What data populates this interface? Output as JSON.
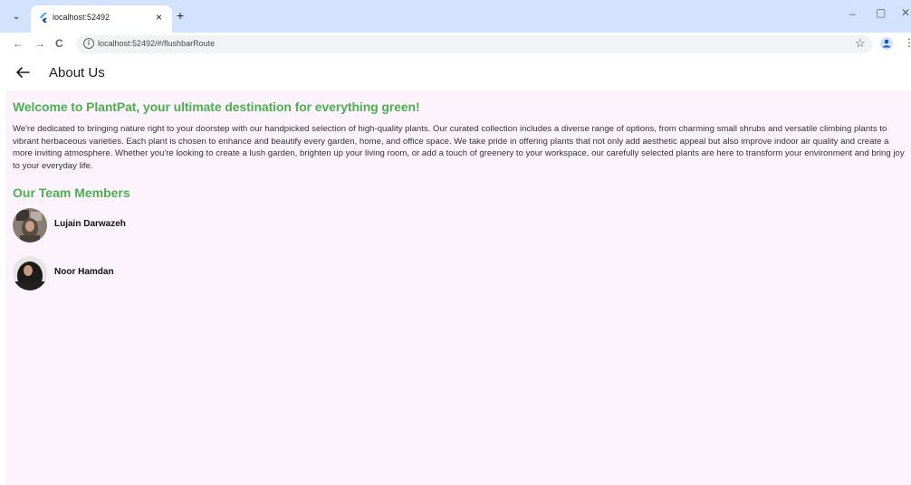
{
  "browser": {
    "tab_title": "localhost:52492",
    "tab_close": "×",
    "new_tab": "+",
    "url": "localhost:52492/#/flushbarRoute",
    "back": "←",
    "forward": "→",
    "reload": "C",
    "window_min": "–",
    "window_restore": "▢",
    "window_close": "✕",
    "star": "☆",
    "menu": "⋮",
    "tab_list": "⌄"
  },
  "appbar": {
    "title": "About Us"
  },
  "content": {
    "welcome": "Welcome to PlantPat, your ultimate destination for everything green!",
    "description": "We're dedicated to bringing nature right to your doorstep with our handpicked selection of high-quality plants. Our curated collection includes a diverse range of options, from charming small shrubs and versatile climbing plants to vibrant herbaceous varieties. Each plant is chosen to enhance and beautify every garden, home, and office space. We take pride in offering plants that not only add aesthetic appeal but also improve indoor air quality and create a more inviting atmosphere. Whether you're looking to create a lush garden, brighten up your living room, or add a touch of greenery to your workspace, our carefully selected plants are here to transform your environment and bring joy to your everyday life.",
    "team_title": "Our Team Members",
    "members": [
      {
        "name": "Lujain Darwazeh"
      },
      {
        "name": "Noor Hamdan"
      }
    ]
  },
  "colors": {
    "accent_green": "#4caf50",
    "content_bg": "#fdf3fc",
    "tabbar_bg": "#d3e3fd"
  }
}
